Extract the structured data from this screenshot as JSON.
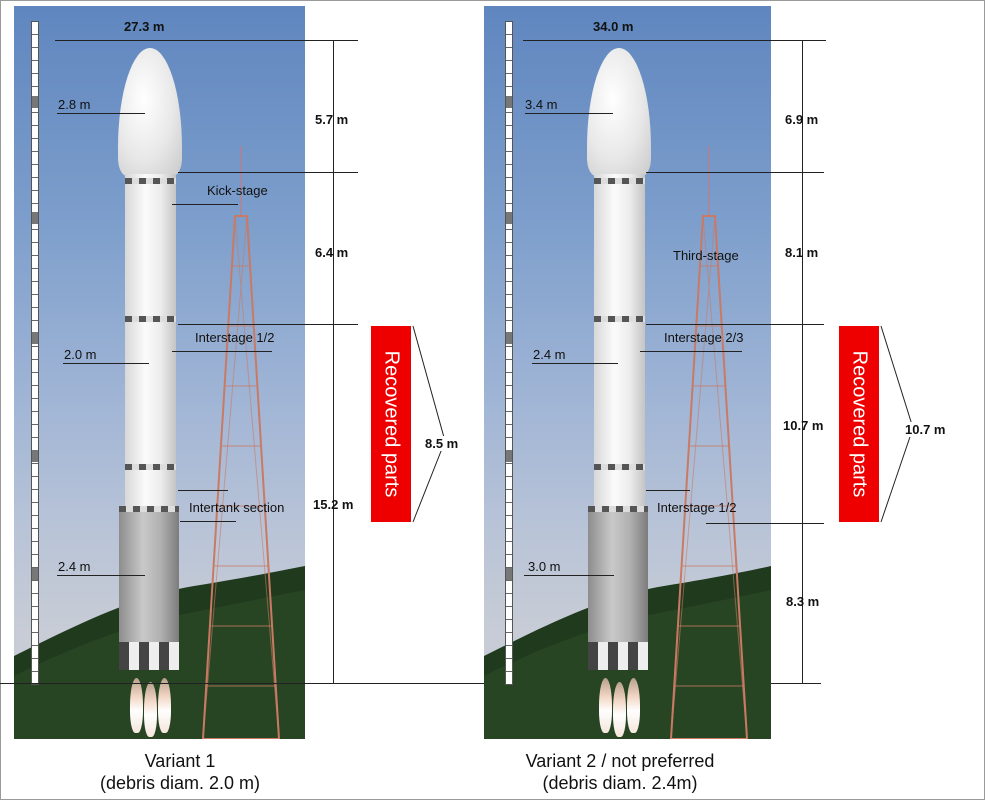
{
  "variant1": {
    "total_height": "27.3 m",
    "stage_lengths": [
      "5.7 m",
      "6.4 m",
      "15.2 m"
    ],
    "recovered_length": "8.5 m",
    "diameters": [
      "2.8 m",
      "2.0 m",
      "2.4 m"
    ],
    "sections": [
      "Kick-stage",
      "Interstage 1/2",
      "Intertank section"
    ],
    "recovered_label": "Recovered parts",
    "caption_line1": "Variant 1",
    "caption_line2": "(debris diam. 2.0 m)"
  },
  "variant2": {
    "total_height": "34.0 m",
    "stage_lengths": [
      "6.9 m",
      "8.1 m",
      "10.7 m",
      "8.3 m"
    ],
    "recovered_length": "10.7 m",
    "diameters": [
      "3.4 m",
      "2.4 m",
      "3.0 m"
    ],
    "sections": [
      "Third-stage",
      "Interstage 2/3",
      "Interstage 1/2"
    ],
    "recovered_label": "Recovered parts",
    "caption_line1": "Variant 2 / not preferred",
    "caption_line2": "(debris diam. 2.4m)"
  },
  "colors": {
    "recovered": "#ee0000",
    "sky": "#7e9fcc",
    "hill": "#1f3a1c"
  }
}
